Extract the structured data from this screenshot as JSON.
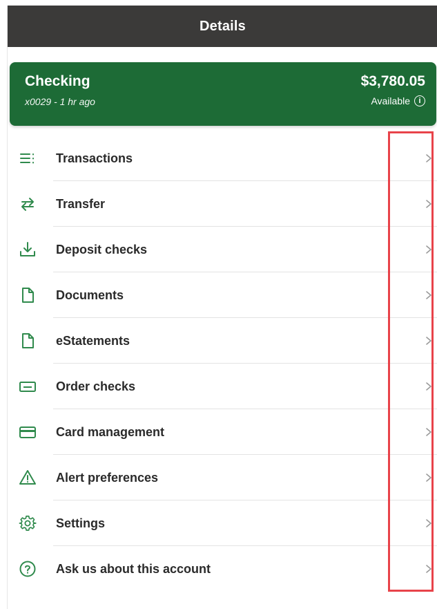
{
  "header": {
    "title": "Details"
  },
  "account": {
    "name": "Checking",
    "subtitle": "x0029 - 1 hr ago",
    "balance": "$3,780.05",
    "available_label": "Available",
    "info_glyph": "i"
  },
  "menu": {
    "items": [
      {
        "label": "Transactions",
        "icon": "list-icon"
      },
      {
        "label": "Transfer",
        "icon": "transfer-arrows-icon"
      },
      {
        "label": "Deposit checks",
        "icon": "download-icon"
      },
      {
        "label": "Documents",
        "icon": "document-icon"
      },
      {
        "label": "eStatements",
        "icon": "document-icon"
      },
      {
        "label": "Order checks",
        "icon": "check-icon"
      },
      {
        "label": "Card management",
        "icon": "credit-card-icon"
      },
      {
        "label": "Alert preferences",
        "icon": "warning-icon"
      },
      {
        "label": "Settings",
        "icon": "gear-icon"
      },
      {
        "label": "Ask us about this account",
        "icon": "help-circle-icon"
      }
    ]
  },
  "colors": {
    "header_bg": "#3b3a39",
    "brand_green": "#1d6b36",
    "icon_green": "#2f8a4c",
    "highlight_red": "#e8434a"
  }
}
